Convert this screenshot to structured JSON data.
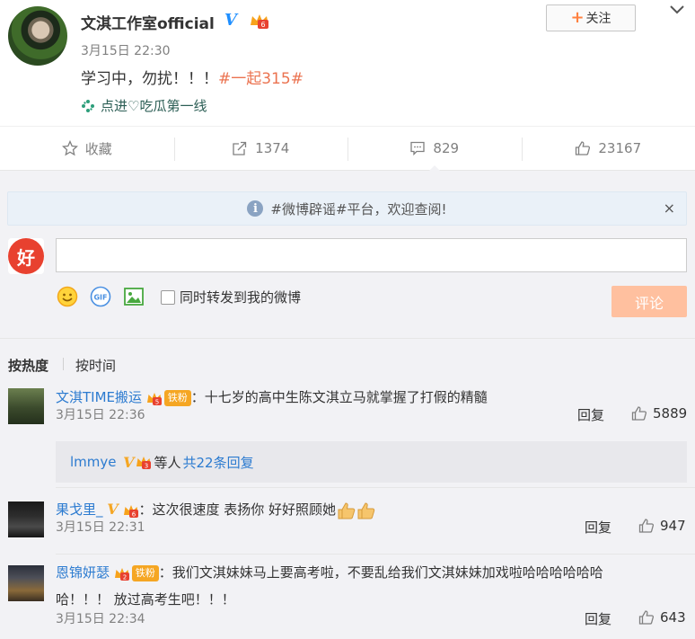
{
  "post": {
    "author": "文淇工作室official",
    "time": "3月15日 22:30",
    "text": "学习中，勿扰！！！",
    "hashtag": "#一起315#",
    "source": "点进♡吃瓜第一线",
    "follow_label": "关注"
  },
  "actions": {
    "favorite_label": "收藏",
    "repost_count": "1374",
    "comment_count": "829",
    "like_count": "23167"
  },
  "notice": {
    "text": "#微博辟谣#平台，欢迎查阅!",
    "close": "×"
  },
  "composer": {
    "avatar_text": "好",
    "input_value": "",
    "gif_label": "GIF",
    "forward_label": "同时转发到我的微博",
    "submit_label": "评论"
  },
  "sort": {
    "hot": "按热度",
    "time": "按时间"
  },
  "comments": [
    {
      "user": "文淇TIME搬运",
      "fan_level": "5",
      "fan_label": "铁粉",
      "text": "：十七岁的高中生陈文淇立马就掌握了打假的精髓",
      "time": "3月15日 22:36",
      "reply_label": "回复",
      "likes": "5889",
      "subreply_user": "lmmye",
      "subreply_text": "等人",
      "subreply_link": "共22条回复",
      "sub_level": "3"
    },
    {
      "user": "果戈里_",
      "fan_level": "6",
      "text": "：这次很速度 表扬你 好好照顾她",
      "time": "3月15日 22:31",
      "reply_label": "回复",
      "likes": "947"
    },
    {
      "user": "恩锦妍瑟",
      "fan_level": "2",
      "fan_label": "铁粉",
      "text": "：我们文淇妹妹马上要高考啦，不要乱给我们文淇妹妹加戏啦哈哈哈哈哈哈",
      "text_line2": "哈！！！ 放过高考生吧！！！",
      "time": "3月15日 22:34",
      "reply_label": "回复",
      "likes": "643"
    }
  ],
  "colors": {
    "accent": "#eb7350",
    "link": "#2c7bd0",
    "submit": "#ffc09f",
    "verified": "#1f8fff",
    "background": "#f2f2f5"
  }
}
